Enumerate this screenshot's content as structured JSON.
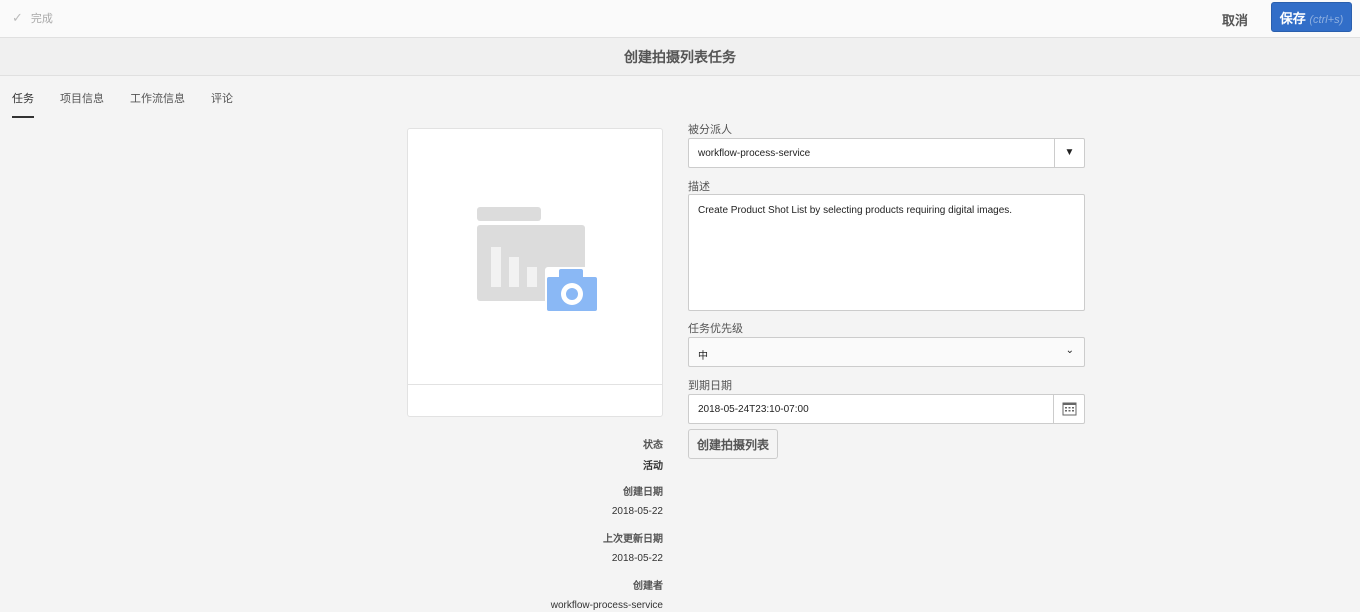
{
  "topbar": {
    "done_label": "完成",
    "cancel_label": "取消",
    "save_label": "保存",
    "save_shortcut": "(ctrl+s)"
  },
  "title": "创建拍摄列表任务",
  "tabs": [
    {
      "label": "任务"
    },
    {
      "label": "项目信息"
    },
    {
      "label": "工作流信息"
    },
    {
      "label": "评论"
    }
  ],
  "meta": [
    {
      "key": "状态",
      "value": "活动"
    },
    {
      "key": "创建日期",
      "value": "2018-05-22"
    },
    {
      "key": "上次更新日期",
      "value": "2018-05-22"
    },
    {
      "key": "创建者",
      "value": "workflow-process-service"
    }
  ],
  "form": {
    "assignee_label": "被分派人",
    "assignee_value": "workflow-process-service",
    "description_label": "描述",
    "description_value": "Create Product Shot List by selecting products requiring digital images.",
    "priority_label": "任务优先级",
    "priority_value": "中",
    "due_label": "到期日期",
    "due_value": "2018-05-24T23:10-07:00",
    "action_label": "创建拍摄列表"
  },
  "colors": {
    "accent": "#326ec8",
    "camera": "#8ab8f5"
  }
}
